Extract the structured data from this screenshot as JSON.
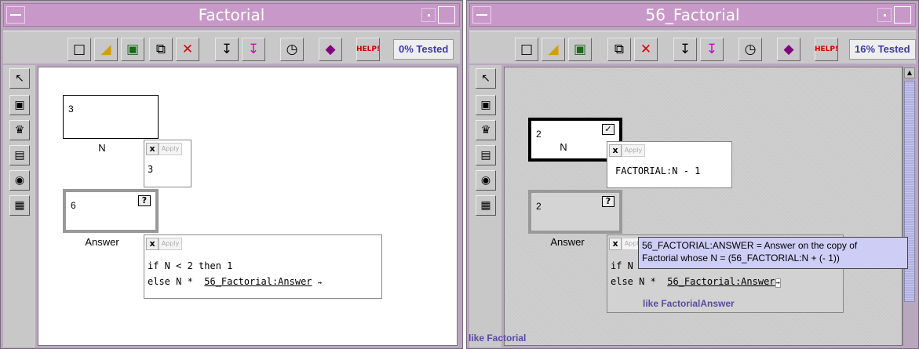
{
  "windows": [
    {
      "title": "Factorial",
      "tested": "0% Tested",
      "cells": {
        "n": {
          "value": "3",
          "label": "N"
        },
        "answer": {
          "value": "6",
          "label": "Answer",
          "check": "?"
        }
      },
      "formulas": {
        "n": {
          "x_label": "x",
          "apply_label": "Apply",
          "text": "3"
        },
        "answer": {
          "x_label": "x",
          "apply_label": "Apply",
          "line1": "if N < 2 then 1",
          "line2_prefix": "else N *  ",
          "line2_ref": "56_Factorial:Answer",
          "arrow": "⇝"
        }
      }
    },
    {
      "title": "56_Factorial",
      "tested": "16% Tested",
      "cells": {
        "n": {
          "value": "2",
          "label": "N",
          "check": "✓"
        },
        "answer": {
          "value": "2",
          "label": "Answer",
          "check": "?"
        }
      },
      "formulas": {
        "n": {
          "x_label": "x",
          "apply_label": "Apply",
          "text": "FACTORIAL:N - 1"
        },
        "answer": {
          "x_label": "x",
          "apply_label": "Apply",
          "line1": "if N < 2 then 1",
          "line2_prefix": "else N *  ",
          "line2_ref": "56_Factorial:Answer",
          "arrow": "⇝"
        }
      },
      "ghost_text": "like FactorialAnswer",
      "tooltip_line1": "56_FACTORIAL:ANSWER = Answer on the copy of",
      "tooltip_line2": "Factorial whose N = (56_FACTORIAL:N + (- 1))",
      "status": "like Factorial"
    }
  ],
  "icons": [
    "new-icon",
    "open-icon",
    "save-icon",
    "copy-icon",
    "delete-icon",
    "import-icon",
    "export-icon",
    "timer-icon",
    "book-icon",
    "help-icon"
  ],
  "palette_icons": [
    "arrow-tool-icon",
    "cell-tool-icon",
    "crown-tool-icon",
    "box-tool-icon",
    "radio-tool-icon",
    "grid-tool-icon"
  ]
}
